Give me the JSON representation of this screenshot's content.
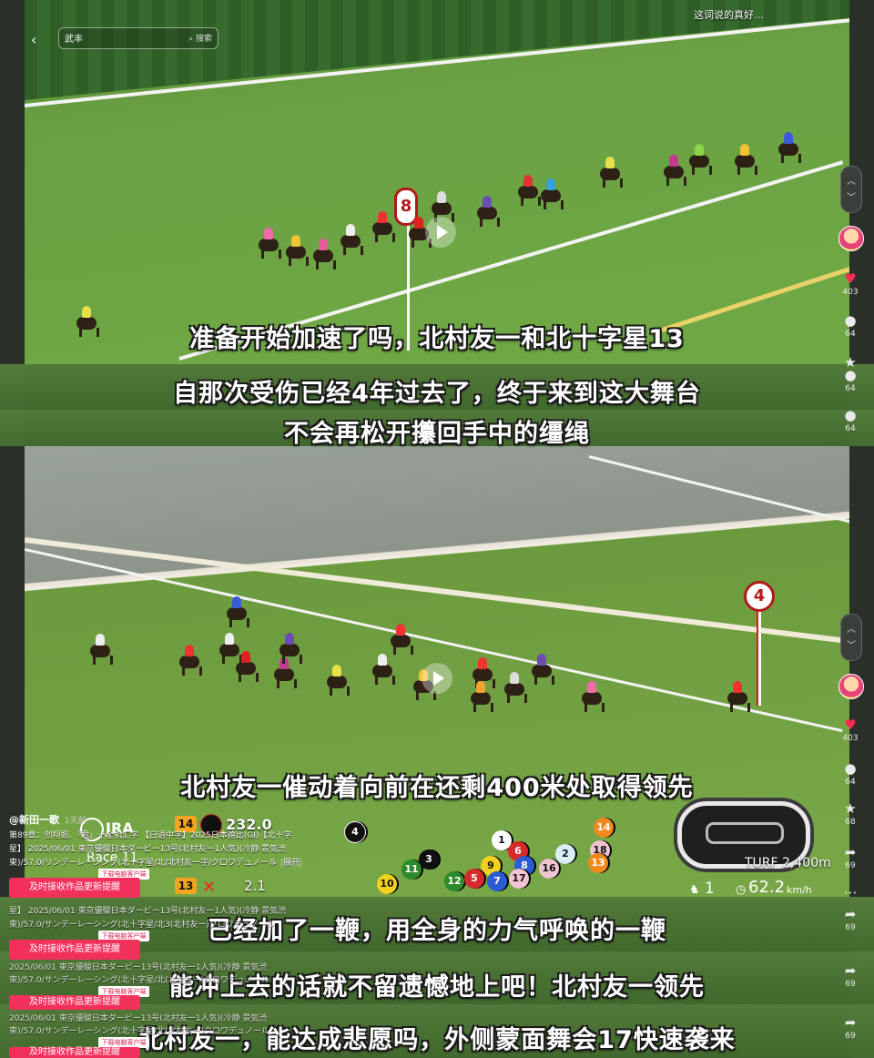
{
  "search": {
    "value": "武丰",
    "button_label": "搜索"
  },
  "top_text": "这词说的真好…",
  "subtitles": [
    "准备开始加速了吗，北村友一和北十字星13",
    "自那次受伤已经4年过去了，终于来到这大舞台",
    "不会再松开攥回手中的缰绳",
    "北村友一催动着向前在还剩400米处取得领先",
    "已经加了一鞭，用全身的力气呼唤的一鞭",
    "能冲上去的话就不留遗憾地上吧！北村友一领先",
    "北村友一，能达成悲愿吗，外侧蒙面舞会17快速袭来"
  ],
  "race_markers": [
    "8",
    "4"
  ],
  "sidebar": {
    "counts_top": [
      "403",
      "64",
      "64",
      "64"
    ],
    "counts_bottom": [
      "403",
      "64",
      "68",
      "69",
      "69",
      "69",
      "69"
    ]
  },
  "hud": {
    "brand": "JRA",
    "race_label": "Race 11",
    "time_top": "232.0",
    "time_bottom": "2.1",
    "box_top": "14",
    "box_bottom": "13",
    "turf": "TURF 2,400m",
    "speed": "62.2",
    "speed_unit": "km/h",
    "position_prefix": "1",
    "saddles": [
      "4",
      "1",
      "3",
      "6",
      "2",
      "14",
      "11",
      "9",
      "8",
      "18",
      "13",
      "10",
      "12",
      "5",
      "7",
      "17",
      "16"
    ]
  },
  "info": {
    "author": "@新田一歌",
    "time_ago": "1天前",
    "line1": "第89章：创翔姬、「君」十全机汇字 【日语中字】2025日本德比(GI)【北十字",
    "line2": "星】 2025/06/01 東京優駿日本ダービー13号(北村友一1人気)(冷静 景気渋",
    "line3": "東)/57.0/リンデーレーシング(北十字星/北/北村友一字/クロワデュノール",
    "expand": "展开",
    "line4": "星】 2025/06/01 東京優駿日本ダービー13号(北村友一1人気)(冷静 景気渋",
    "line5": "東)/57.0/サンデーレーシング(北十字星/北3(北村友一)クロワデュノール",
    "line6": "2025/06/01 東京優駿日本ダービー13号(北村友一1人気)(冷静 景気渋",
    "line7": "東)/57.0/サンデーレーシング(北十字星/北(北村友一)クロワデュノール",
    "line8": "2025/06/01 東京優駿日本ダービー13号(北村友一1人気)(冷静 景気渋",
    "line9": "東)/57.0/サンデーレーシング(北十字星/北(北村友一)クロワデュノール",
    "tag": "下载电脑客户端",
    "button": "及时接收作品更新提醒"
  }
}
